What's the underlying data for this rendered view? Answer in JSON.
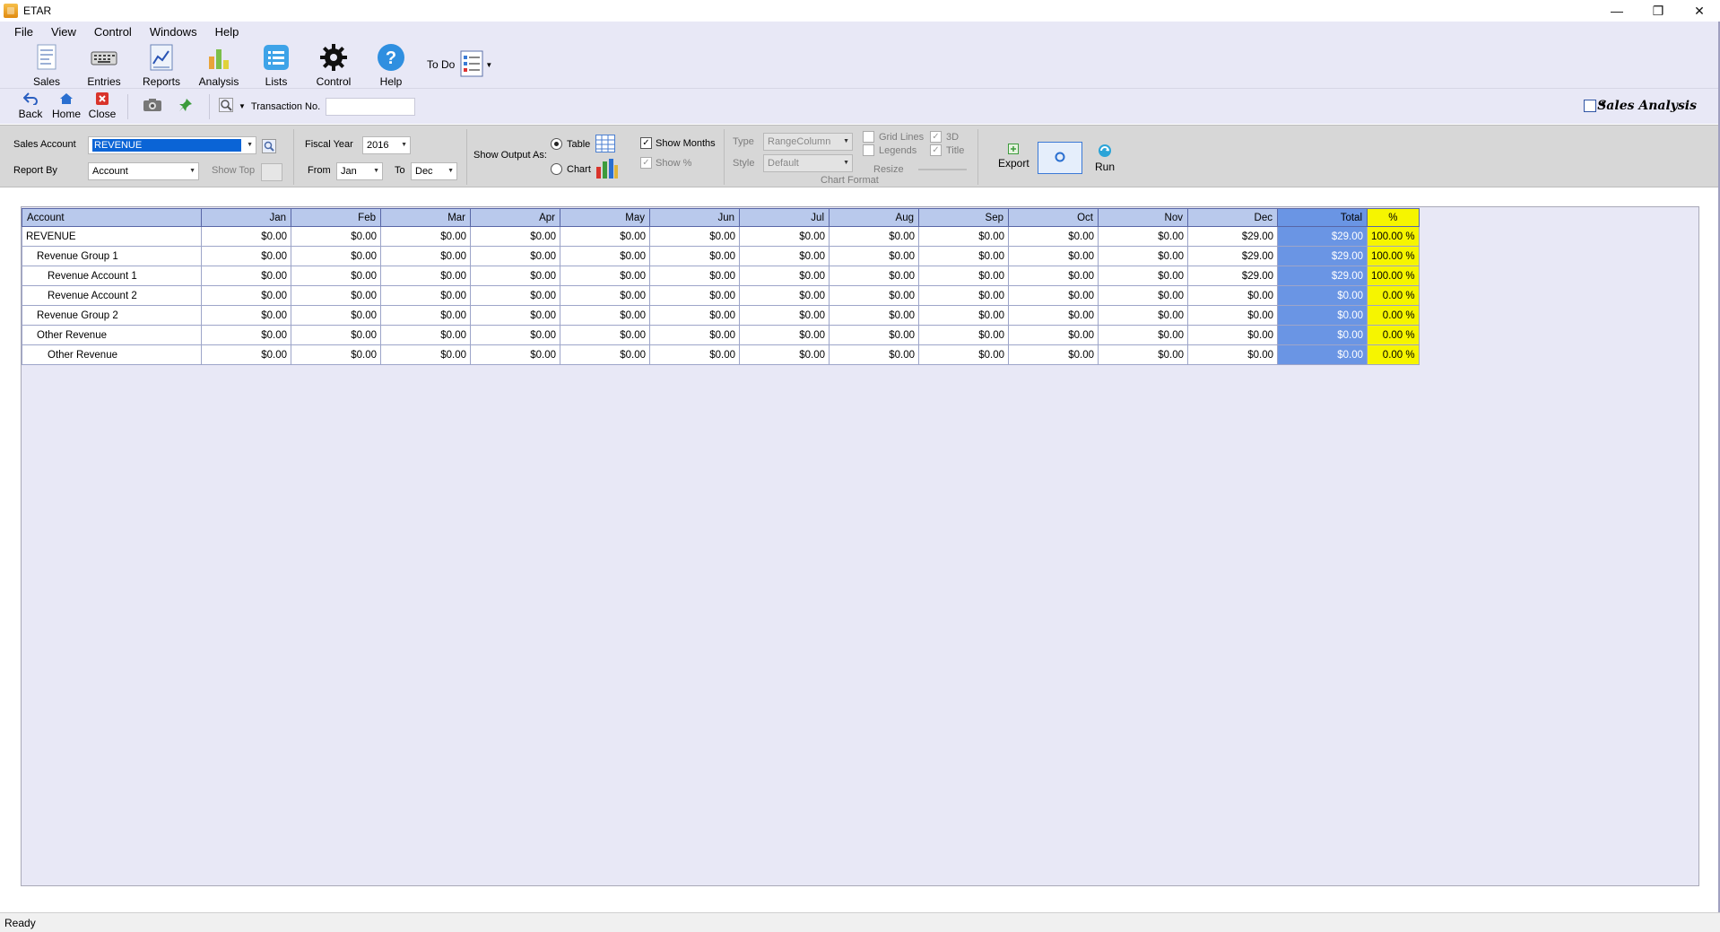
{
  "window": {
    "title": "ETAR",
    "minimize": "—",
    "restore": "❐",
    "close": "✕"
  },
  "menu": [
    "File",
    "View",
    "Control",
    "Windows",
    "Help"
  ],
  "toolbar": {
    "sales": "Sales",
    "entries": "Entries",
    "reports": "Reports",
    "analysis": "Analysis",
    "lists": "Lists",
    "control": "Control",
    "help": "Help",
    "todo": "To Do"
  },
  "subtoolbar": {
    "back": "Back",
    "home": "Home",
    "close": "Close",
    "transaction_label": "Transaction No.",
    "transaction_value": "",
    "view_title": "Sales Analysis"
  },
  "filters": {
    "sales_account_label": "Sales Account",
    "sales_account_value": "REVENUE",
    "report_by_label": "Report By",
    "report_by_value": "Account",
    "show_top_label": "Show Top",
    "fiscal_year_label": "Fiscal Year",
    "fiscal_year_value": "2016",
    "from_label": "From",
    "from_value": "Jan",
    "to_label": "To",
    "to_value": "Dec",
    "show_output_label": "Show Output As:",
    "table_label": "Table",
    "chart_label": "Chart",
    "show_months_label": "Show Months",
    "show_pct_label": "Show %",
    "type_label": "Type",
    "type_value": "RangeColumn",
    "style_label": "Style",
    "style_value": "Default",
    "grid_lines_label": "Grid Lines",
    "legends_label": "Legends",
    "threed_label": "3D",
    "title_label": "Title",
    "resize_label": "Resize",
    "chart_format_label": "Chart Format",
    "export_label": "Export",
    "run_label": "Run"
  },
  "grid": {
    "columns": [
      "Account",
      "Jan",
      "Feb",
      "Mar",
      "Apr",
      "May",
      "Jun",
      "Jul",
      "Aug",
      "Sep",
      "Oct",
      "Nov",
      "Dec",
      "Total",
      "%"
    ],
    "rows": [
      {
        "level": 0,
        "cells": [
          "REVENUE",
          "$0.00",
          "$0.00",
          "$0.00",
          "$0.00",
          "$0.00",
          "$0.00",
          "$0.00",
          "$0.00",
          "$0.00",
          "$0.00",
          "$0.00",
          "$29.00",
          "$29.00",
          "100.00 %"
        ]
      },
      {
        "level": 1,
        "cells": [
          "Revenue Group 1",
          "$0.00",
          "$0.00",
          "$0.00",
          "$0.00",
          "$0.00",
          "$0.00",
          "$0.00",
          "$0.00",
          "$0.00",
          "$0.00",
          "$0.00",
          "$29.00",
          "$29.00",
          "100.00 %"
        ]
      },
      {
        "level": 2,
        "cells": [
          "Revenue Account 1",
          "$0.00",
          "$0.00",
          "$0.00",
          "$0.00",
          "$0.00",
          "$0.00",
          "$0.00",
          "$0.00",
          "$0.00",
          "$0.00",
          "$0.00",
          "$29.00",
          "$29.00",
          "100.00 %"
        ]
      },
      {
        "level": 2,
        "cells": [
          "Revenue Account 2",
          "$0.00",
          "$0.00",
          "$0.00",
          "$0.00",
          "$0.00",
          "$0.00",
          "$0.00",
          "$0.00",
          "$0.00",
          "$0.00",
          "$0.00",
          "$0.00",
          "$0.00",
          "0.00 %"
        ]
      },
      {
        "level": 1,
        "cells": [
          "Revenue Group 2",
          "$0.00",
          "$0.00",
          "$0.00",
          "$0.00",
          "$0.00",
          "$0.00",
          "$0.00",
          "$0.00",
          "$0.00",
          "$0.00",
          "$0.00",
          "$0.00",
          "$0.00",
          "0.00 %"
        ]
      },
      {
        "level": 1,
        "cells": [
          "Other Revenue",
          "$0.00",
          "$0.00",
          "$0.00",
          "$0.00",
          "$0.00",
          "$0.00",
          "$0.00",
          "$0.00",
          "$0.00",
          "$0.00",
          "$0.00",
          "$0.00",
          "$0.00",
          "0.00 %"
        ]
      },
      {
        "level": 2,
        "cells": [
          "Other Revenue",
          "$0.00",
          "$0.00",
          "$0.00",
          "$0.00",
          "$0.00",
          "$0.00",
          "$0.00",
          "$0.00",
          "$0.00",
          "$0.00",
          "$0.00",
          "$0.00",
          "$0.00",
          "0.00 %"
        ]
      }
    ]
  },
  "status": {
    "text": "Ready"
  },
  "colors": {
    "total_col": "#6a95e4",
    "pct_col": "#f6f500",
    "header": "#b9c9ec",
    "selection": "#0a64d6"
  }
}
